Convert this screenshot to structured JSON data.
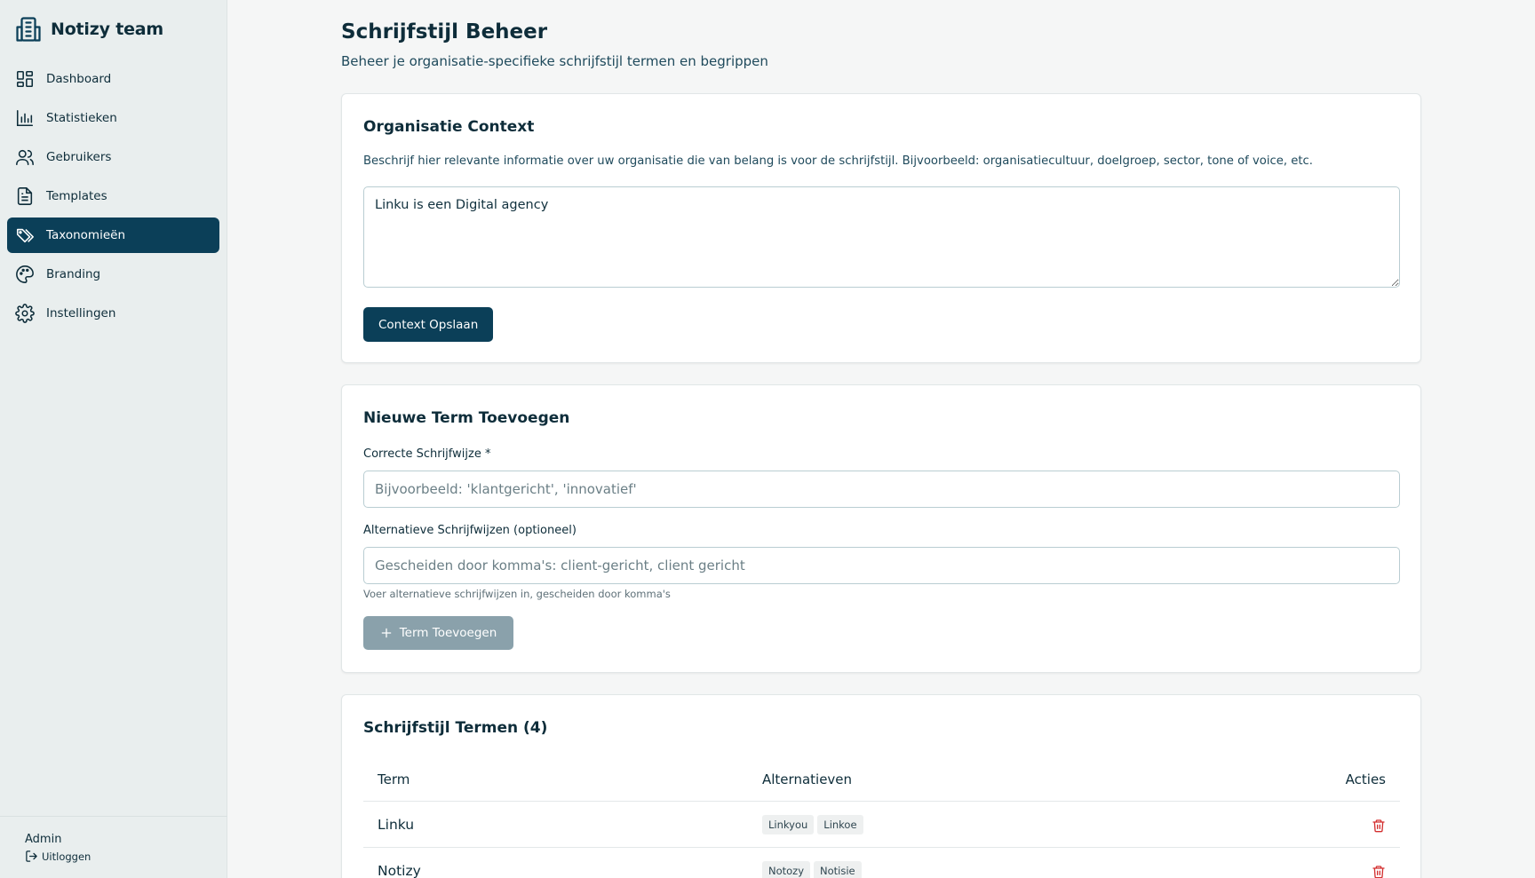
{
  "app": {
    "name": "Notizy team"
  },
  "sidebar": {
    "items": [
      {
        "label": "Dashboard",
        "icon": "dashboard-icon",
        "active": false
      },
      {
        "label": "Statistieken",
        "icon": "bar-chart-icon",
        "active": false
      },
      {
        "label": "Gebruikers",
        "icon": "users-icon",
        "active": false
      },
      {
        "label": "Templates",
        "icon": "document-icon",
        "active": false
      },
      {
        "label": "Taxonomieën",
        "icon": "tags-icon",
        "active": true
      },
      {
        "label": "Branding",
        "icon": "palette-icon",
        "active": false
      },
      {
        "label": "Instellingen",
        "icon": "gear-icon",
        "active": false
      }
    ],
    "user": {
      "name": "Admin",
      "logout_label": "Uitloggen"
    }
  },
  "page": {
    "title": "Schrijfstijl Beheer",
    "subtitle": "Beheer je organisatie-specifieke schrijfstijl termen en begrippen"
  },
  "context_card": {
    "title": "Organisatie Context",
    "help": "Beschrijf hier relevante informatie over uw organisatie die van belang is voor de schrijfstijl. Bijvoorbeeld: organisatiecultuur, doelgroep, sector, tone of voice, etc.",
    "value": "Linku is een Digital agency",
    "save_label": "Context Opslaan"
  },
  "new_term_card": {
    "title": "Nieuwe Term Toevoegen",
    "correct_label": "Correcte Schrijfwijze *",
    "correct_placeholder": "Bijvoorbeeld: 'klantgericht', 'innovatief'",
    "correct_value": "",
    "alt_label": "Alternatieve Schrijfwijzen (optioneel)",
    "alt_placeholder": "Gescheiden door komma's: client-gericht, client gericht",
    "alt_value": "",
    "alt_hint": "Voer alternatieve schrijfwijzen in, gescheiden door komma's",
    "add_label": "Term Toevoegen"
  },
  "terms_card": {
    "title": "Schrijfstijl Termen (4)",
    "columns": {
      "term": "Term",
      "alternatives": "Alternatieven",
      "actions": "Acties"
    },
    "rows": [
      {
        "term": "Linku",
        "alternatives": [
          "Linkyou",
          "Linkoe"
        ]
      },
      {
        "term": "Notizy",
        "alternatives": [
          "Notozy",
          "Notisie"
        ]
      }
    ]
  },
  "colors": {
    "primary": "#0b3f58",
    "sidebar_bg": "#e9eeee",
    "page_bg": "#f5f6f6",
    "danger": "#d32f2f",
    "disabled": "#8aa1ab"
  }
}
